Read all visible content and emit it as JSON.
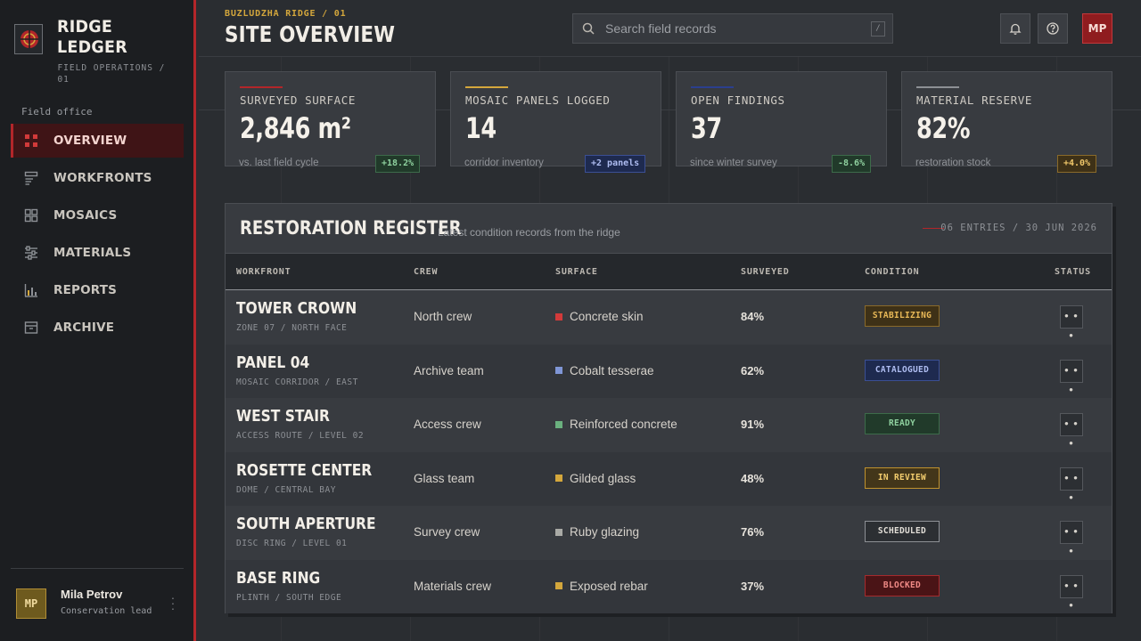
{
  "brand": {
    "title": "RIDGE LEDGER",
    "subtitle": "FIELD OPERATIONS / 01",
    "logo_icon": "crosshair-icon"
  },
  "sidebar": {
    "section_label": "Field office",
    "items": [
      {
        "label": "OVERVIEW",
        "icon": "grid-icon",
        "active": true
      },
      {
        "label": "WORKFRONTS",
        "icon": "layers-icon"
      },
      {
        "label": "MOSAICS",
        "icon": "tiles-icon"
      },
      {
        "label": "MATERIALS",
        "icon": "sliders-icon"
      },
      {
        "label": "REPORTS",
        "icon": "bar-chart-icon"
      },
      {
        "label": "ARCHIVE",
        "icon": "archive-box-icon"
      }
    ],
    "user": {
      "initials": "MP",
      "name": "Mila Petrov",
      "role": "Conservation lead"
    }
  },
  "header": {
    "eyebrow": "BUZLUDZHA RIDGE / 01",
    "title": "SITE OVERVIEW",
    "search": {
      "placeholder": "Search field records",
      "shortcut": "/"
    },
    "avatar_initials": "MP"
  },
  "kpis": [
    {
      "label": "SURVEYED SURFACE",
      "value": "2,846 m²",
      "note": "vs. last field cycle",
      "delta": "+18.2%",
      "accent": "#b3262a",
      "delta_style": "green"
    },
    {
      "label": "MOSAIC PANELS LOGGED",
      "value": "14",
      "note": "corridor inventory",
      "delta": "+2 panels",
      "accent": "#d4a73c",
      "delta_style": "blue"
    },
    {
      "label": "OPEN FINDINGS",
      "value": "37",
      "note": "since winter survey",
      "delta": "-8.6%",
      "accent": "#2b3f8f",
      "delta_style": "green"
    },
    {
      "label": "MATERIAL RESERVE",
      "value": "82%",
      "note": "restoration stock",
      "delta": "+4.0%",
      "accent": "#8d9095",
      "delta_style": "amber"
    }
  ],
  "register": {
    "title": "RESTORATION REGISTER",
    "subtitle": "Latest condition records from the ridge",
    "meta": "06 ENTRIES / 30 JUN 2026",
    "columns": [
      "WORKFRONT",
      "CREW",
      "SURFACE",
      "SURVEYED",
      "CONDITION",
      "STATUS"
    ],
    "rows": [
      {
        "title": "TOWER CROWN",
        "sub": "ZONE 07 / NORTH FACE",
        "crew": "North crew",
        "surface": "Concrete skin",
        "swatch": "#d23a3a",
        "surveyed": "84%",
        "condition": "STABILIZING",
        "cond_style": "amber"
      },
      {
        "title": "PANEL 04",
        "sub": "MOSAIC CORRIDOR / EAST",
        "crew": "Archive team",
        "surface": "Cobalt tesserae",
        "swatch": "#7f96d6",
        "surveyed": "62%",
        "condition": "CATALOGUED",
        "cond_style": "blue"
      },
      {
        "title": "WEST STAIR",
        "sub": "ACCESS ROUTE / LEVEL 02",
        "crew": "Access crew",
        "surface": "Reinforced concrete",
        "swatch": "#6ab07e",
        "surveyed": "91%",
        "condition": "READY",
        "cond_style": "green"
      },
      {
        "title": "ROSETTE CENTER",
        "sub": "DOME / CENTRAL BAY",
        "crew": "Glass team",
        "surface": "Gilded glass",
        "swatch": "#d4a73c",
        "surveyed": "48%",
        "condition": "IN REVIEW",
        "cond_style": "gold"
      },
      {
        "title": "SOUTH APERTURE",
        "sub": "DISC RING / LEVEL 01",
        "crew": "Survey crew",
        "surface": "Ruby glazing",
        "swatch": "#a9aaa6",
        "surveyed": "76%",
        "condition": "SCHEDULED",
        "cond_style": "neutral"
      },
      {
        "title": "BASE RING",
        "sub": "PLINTH / SOUTH EDGE",
        "crew": "Materials crew",
        "surface": "Exposed rebar",
        "swatch": "#d4a73c",
        "surveyed": "37%",
        "condition": "BLOCKED",
        "cond_style": "red"
      }
    ],
    "more_label": "• • •"
  }
}
